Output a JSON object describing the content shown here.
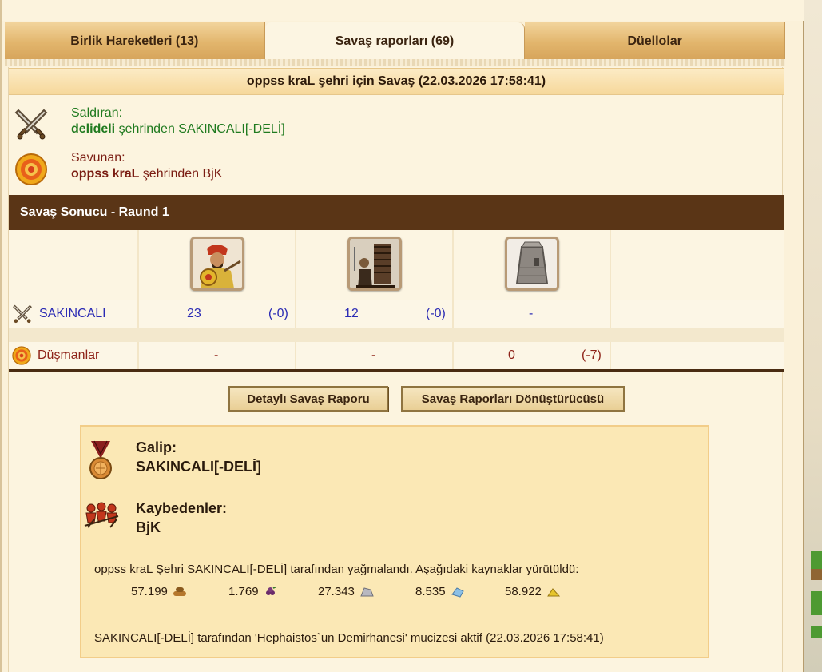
{
  "tabs": [
    {
      "label": "Birlik Hareketleri (13)",
      "active": false
    },
    {
      "label": "Savaş raporları (69)",
      "active": true
    },
    {
      "label": "Düellolar",
      "active": false
    }
  ],
  "report": {
    "title": "oppss kraL şehri için Savaş (22.03.2026 17:58:41)",
    "attacker": {
      "heading": "Saldıran:",
      "player": "delideli",
      "rest": " şehrinden SAKINCALI[-DELİ]"
    },
    "defender": {
      "heading": "Savunan:",
      "player": "oppss kraL",
      "rest": " şehrinden BjK"
    },
    "round_title": "Savaş Sonucu - Raund 1",
    "rows": {
      "attacker": {
        "name": "SAKINCALI",
        "cells": [
          {
            "value": "23",
            "loss": "(-0)"
          },
          {
            "value": "12",
            "loss": "(-0)"
          },
          {
            "value": "-",
            "loss": ""
          }
        ]
      },
      "enemies": {
        "name": "Düşmanlar",
        "cells": [
          {
            "value": "-",
            "loss": ""
          },
          {
            "value": "-",
            "loss": ""
          },
          {
            "value": "0",
            "loss": "(-7)"
          }
        ]
      }
    },
    "buttons": {
      "detailed": "Detaylı Savaş Raporu",
      "converter": "Savaş Raporları Dönüştürücüsü"
    },
    "result": {
      "winner_label": "Galip:",
      "winner_name": "SAKINCALI[-DELİ]",
      "loser_label": "Kaybedenler:",
      "loser_name": "BjK",
      "plunder_text": "oppss kraL Şehri SAKINCALI[-DELİ] tarafından yağmalandı. Aşağıdaki kaynaklar yürütüldü:",
      "resources": [
        {
          "amount": "57.199",
          "icon": "wood-icon"
        },
        {
          "amount": "1.769",
          "icon": "wine-icon"
        },
        {
          "amount": "27.343",
          "icon": "marble-icon"
        },
        {
          "amount": "8.535",
          "icon": "crystal-icon"
        },
        {
          "amount": "58.922",
          "icon": "sulfur-icon"
        }
      ],
      "wonder_text": "SAKINCALI[-DELİ] tarafından 'Hephaistos`un Demirhanesi' mucizesi aktif (22.03.2026 17:58:41)"
    }
  },
  "colors": {
    "attacker": "#1f7a1f",
    "defender": "#7a1c12",
    "round_bar": "#5a3516",
    "blue_values": "#2a2ab4"
  }
}
